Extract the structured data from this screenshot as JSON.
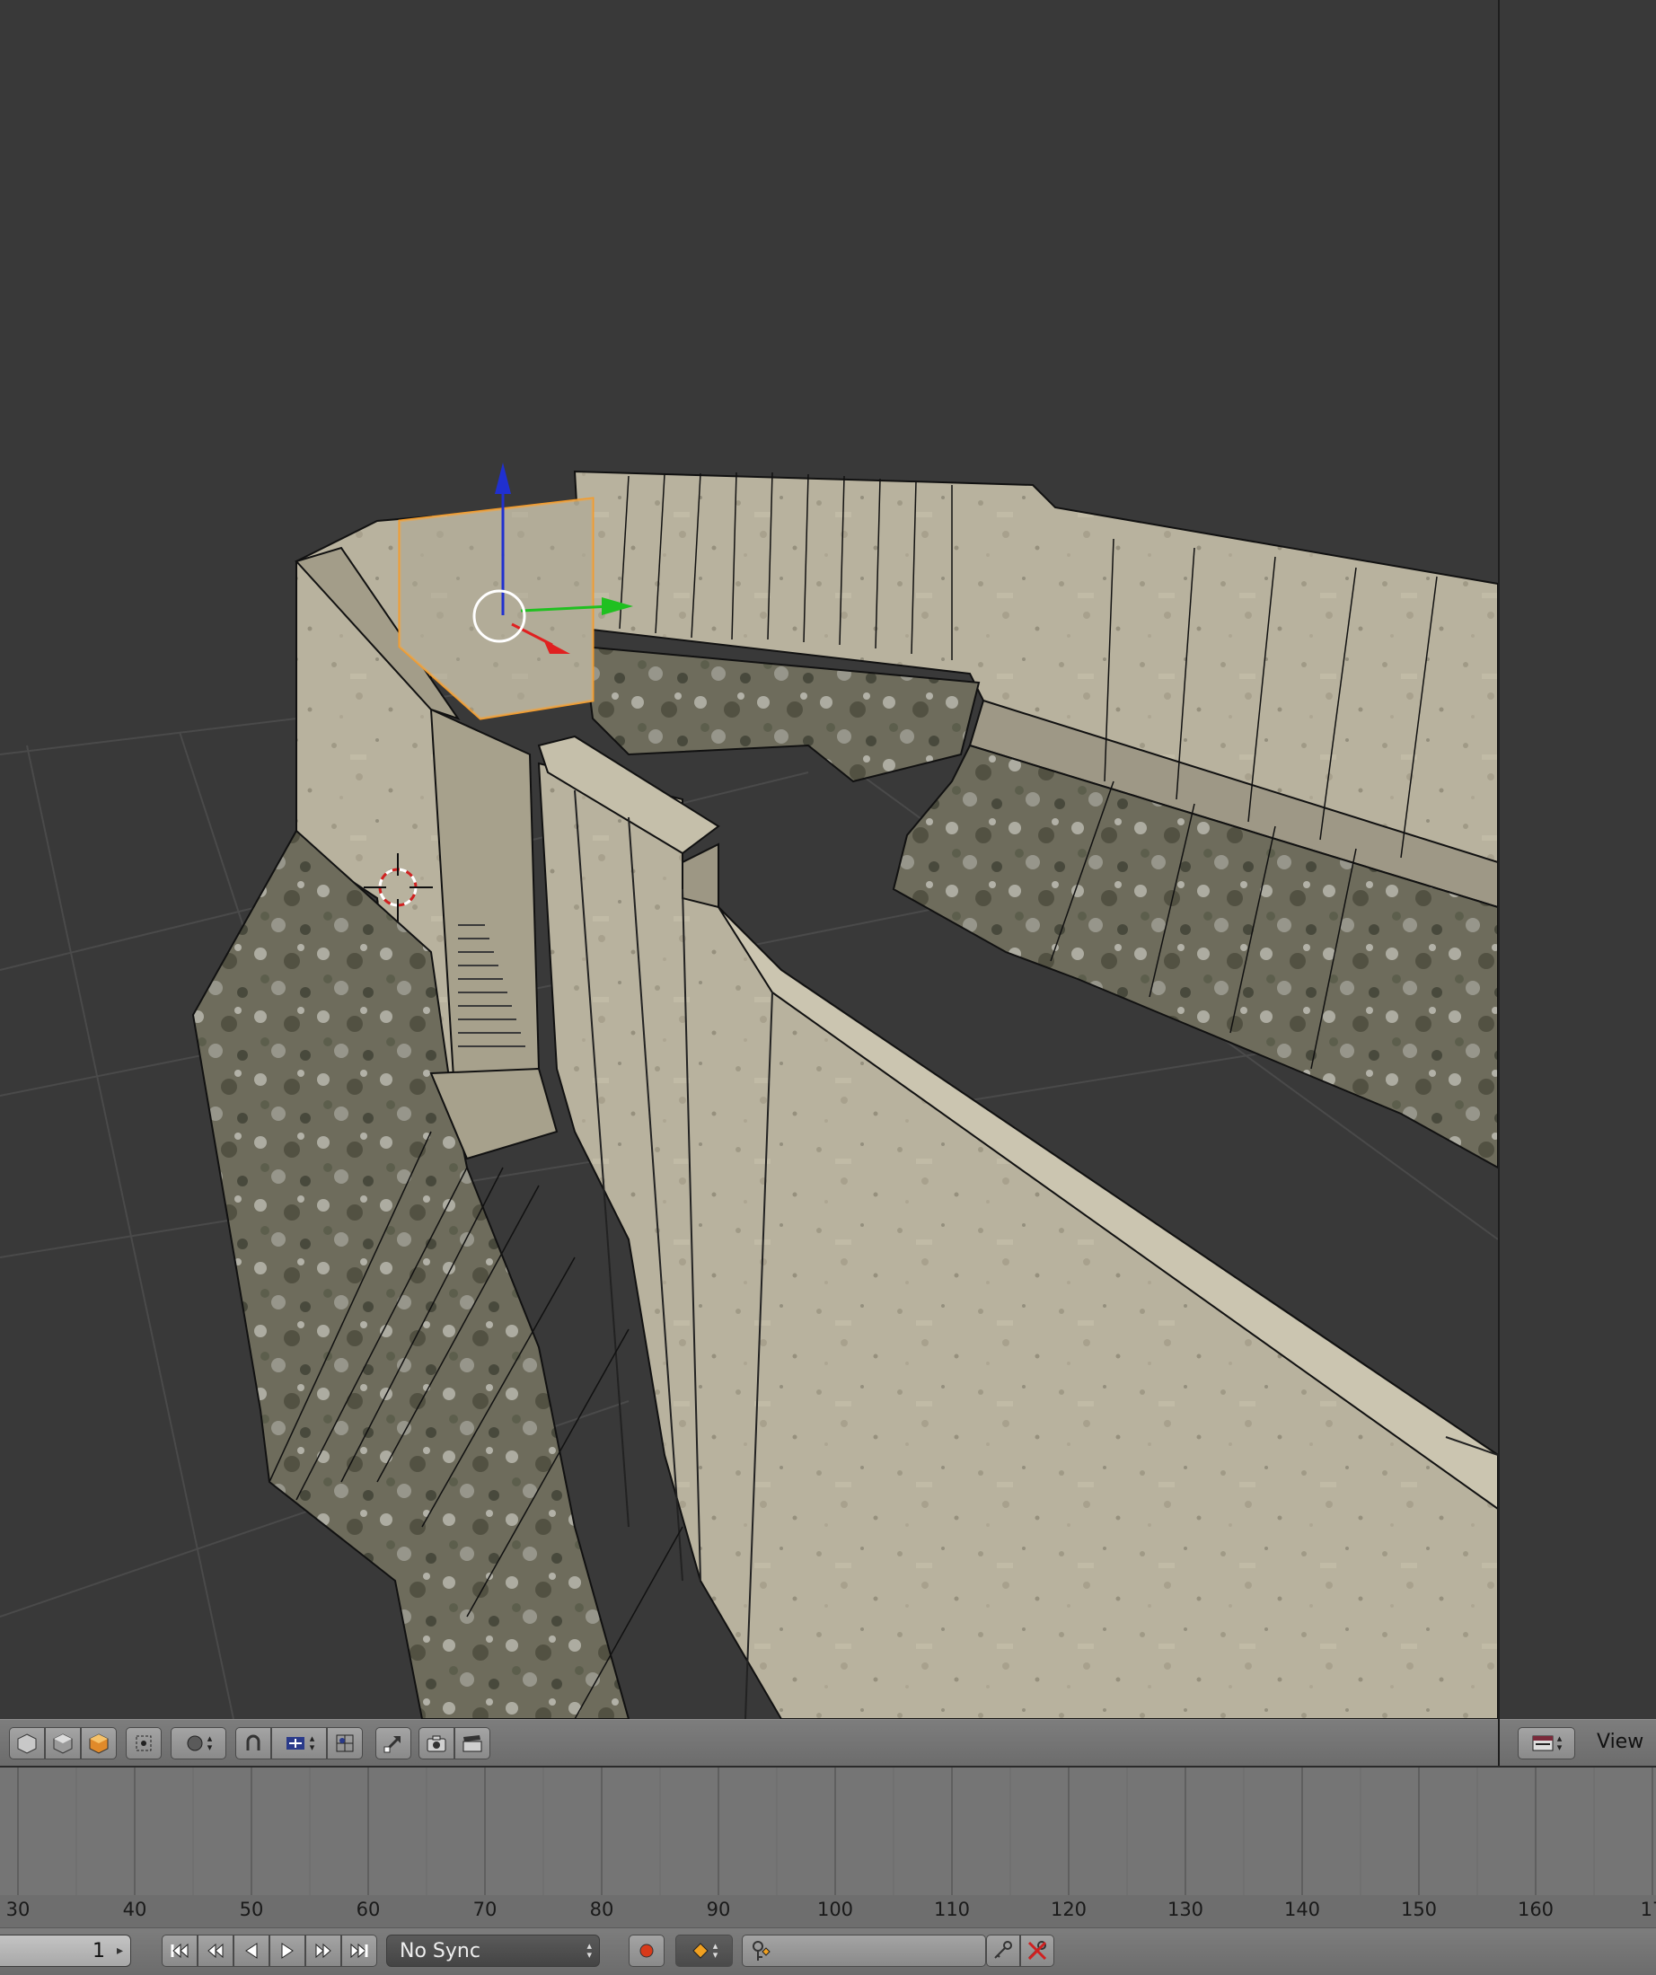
{
  "viewport": {
    "colors": {
      "background": "#393939",
      "grid": "#4a4a4a",
      "concrete": "#b9b39f",
      "rock": "#7c7a6a",
      "selection": "#f39c2d",
      "axis_x": "#e02020",
      "axis_y": "#20c020",
      "axis_z": "#2030d0"
    },
    "icons": {
      "manipulator": "transform-manipulator-icon",
      "cursor": "3d-cursor-icon"
    }
  },
  "view3d_header": {
    "icons": [
      "solid-shading-icon",
      "texture-shading-icon",
      "material-shading-icon",
      "pivot-point-icon",
      "proportional-edit-icon",
      "snap-magnet-icon",
      "snap-element-icon",
      "snap-target-icon",
      "grab-icon",
      "render-camera-icon",
      "render-clapboard-icon"
    ]
  },
  "side_header": {
    "editor_icon": "image-editor-icon",
    "view_label": "View"
  },
  "timeline": {
    "ticks": [
      "30",
      "40",
      "50",
      "60",
      "70",
      "80",
      "90",
      "100",
      "110",
      "120",
      "130",
      "140",
      "150",
      "160",
      "17"
    ],
    "frame_current": "1",
    "sync_mode": "No Sync",
    "playback_icons": [
      "jump-start-icon",
      "prev-keyframe-icon",
      "play-reverse-icon",
      "play-icon",
      "next-keyframe-icon",
      "jump-end-icon"
    ],
    "record_icon": "record-icon",
    "keying_icon": "keyframe-icon",
    "keyset_icon": "keying-set-icon",
    "insert_key_icon": "insert-keyframe-icon",
    "delete_key_icon": "delete-keyframe-icon"
  }
}
